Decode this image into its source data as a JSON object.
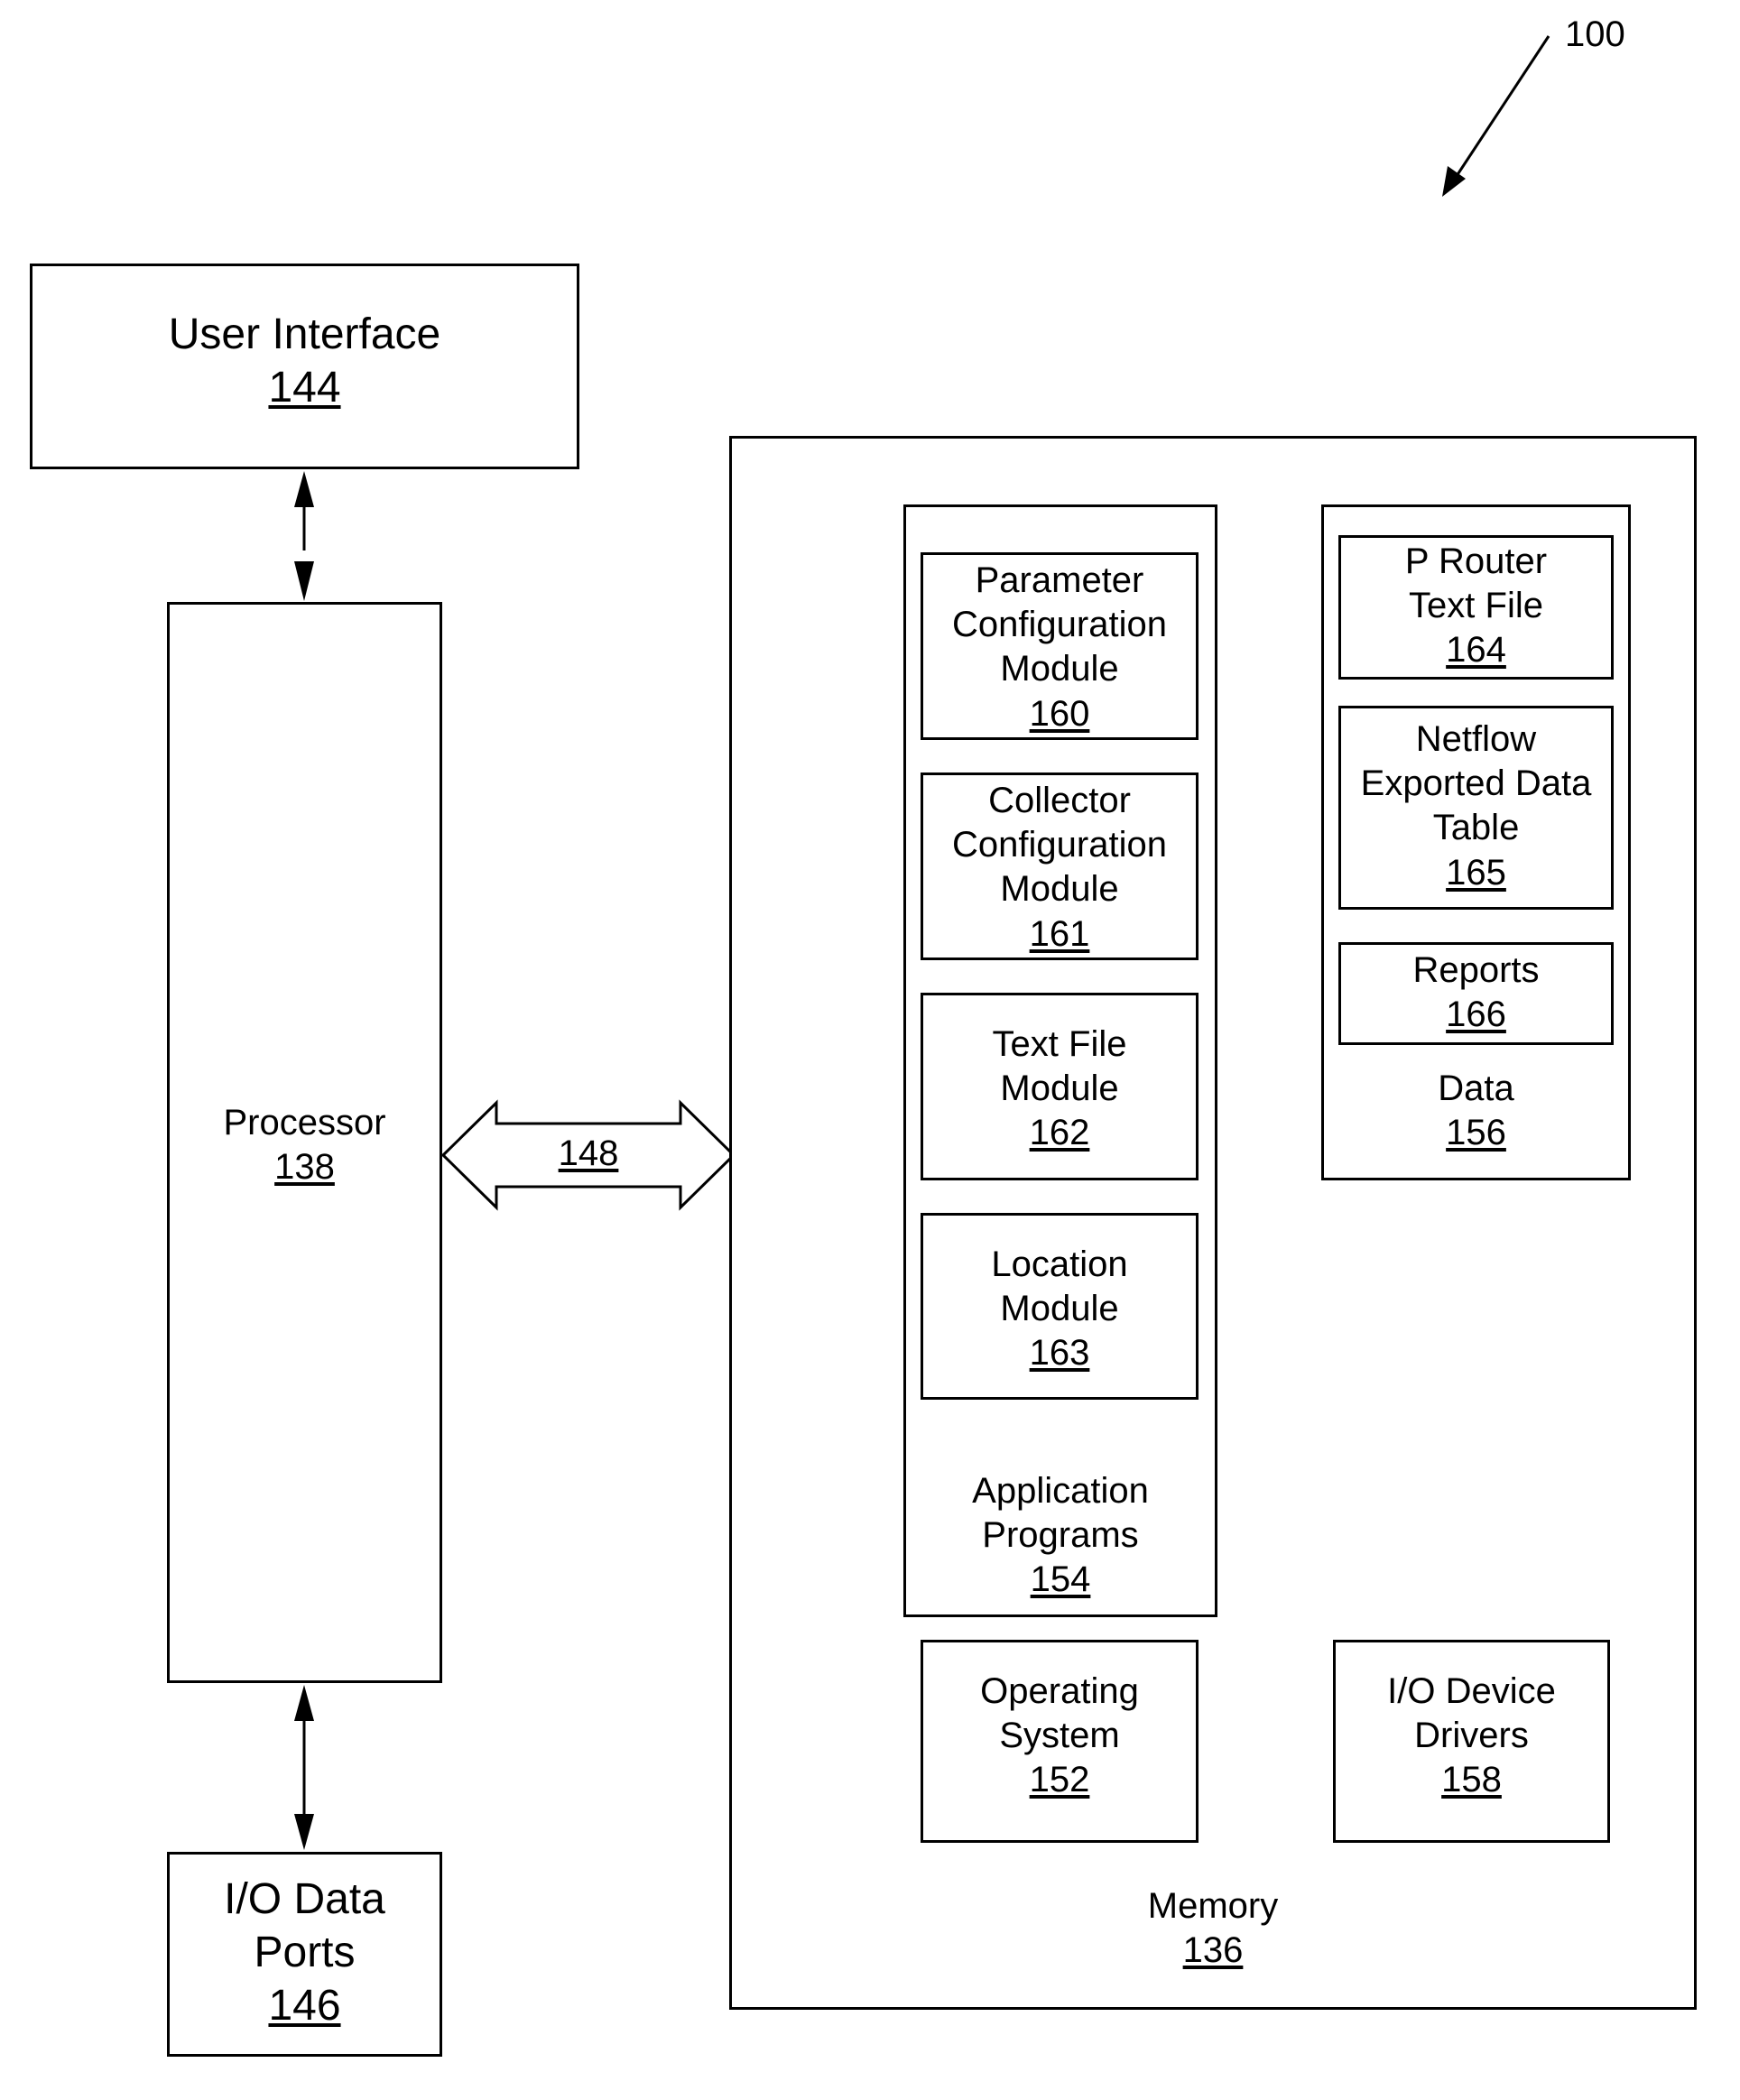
{
  "figure": {
    "ref": "100"
  },
  "user_interface": {
    "lines": [
      "User Interface"
    ],
    "ref": "144"
  },
  "processor": {
    "lines": [
      "Processor"
    ],
    "ref": "138"
  },
  "io_data_ports": {
    "lines": [
      "I/O Data",
      "Ports"
    ],
    "ref": "146"
  },
  "bus": {
    "ref": "148"
  },
  "memory": {
    "lines": [
      "Memory"
    ],
    "ref": "136",
    "application_programs": {
      "lines": [
        "Application",
        "Programs"
      ],
      "ref": "154",
      "modules": [
        {
          "lines": [
            "Parameter",
            "Configuration",
            "Module"
          ],
          "ref": "160"
        },
        {
          "lines": [
            "Collector",
            "Configuration",
            "Module"
          ],
          "ref": "161"
        },
        {
          "lines": [
            "Text File",
            "Module"
          ],
          "ref": "162"
        },
        {
          "lines": [
            "Location",
            "Module"
          ],
          "ref": "163"
        }
      ]
    },
    "data": {
      "lines": [
        "Data"
      ],
      "ref": "156",
      "items": [
        {
          "lines": [
            "P Router",
            "Text File"
          ],
          "ref": "164"
        },
        {
          "lines": [
            "Netflow",
            "Exported Data",
            "Table"
          ],
          "ref": "165"
        },
        {
          "lines": [
            "Reports"
          ],
          "ref": "166"
        }
      ]
    },
    "operating_system": {
      "lines": [
        "Operating",
        "System"
      ],
      "ref": "152"
    },
    "io_device_drivers": {
      "lines": [
        "I/O Device",
        "Drivers"
      ],
      "ref": "158"
    }
  }
}
